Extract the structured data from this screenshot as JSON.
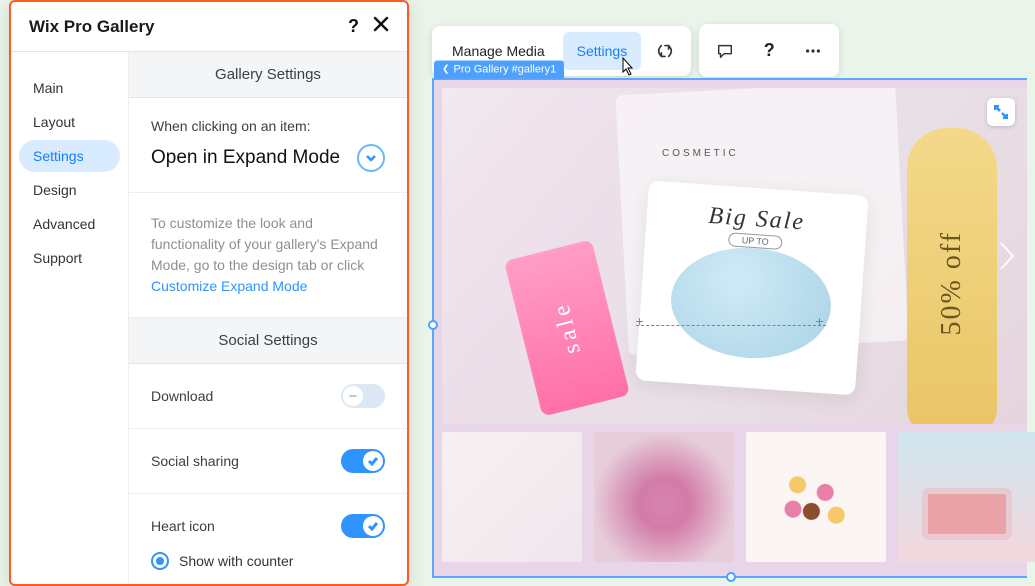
{
  "panel": {
    "title": "Wix Pro Gallery",
    "sidebar": {
      "items": [
        {
          "label": "Main"
        },
        {
          "label": "Layout"
        },
        {
          "label": "Settings"
        },
        {
          "label": "Design"
        },
        {
          "label": "Advanced"
        },
        {
          "label": "Support"
        }
      ]
    },
    "sections": {
      "gallery_header": "Gallery Settings",
      "click_label": "When clicking on an item:",
      "click_value": "Open in Expand Mode",
      "hint_text": "To customize the look and functionality of your gallery's Expand Mode, go to the design tab or click ",
      "hint_link": "Customize Expand Mode",
      "social_header": "Social Settings",
      "download_label": "Download",
      "social_sharing_label": "Social sharing",
      "heart_label": "Heart icon",
      "heart_option": "Show with counter"
    }
  },
  "toolbar": {
    "manage_media": "Manage Media",
    "settings": "Settings"
  },
  "breadcrumb": {
    "label": "Pro Gallery #gallery1"
  },
  "image_text": {
    "cosmetic": "COSMETIC",
    "bigsale": "Big Sale",
    "upto": "UP TO",
    "sale": "sale",
    "fifty": "50% off"
  }
}
